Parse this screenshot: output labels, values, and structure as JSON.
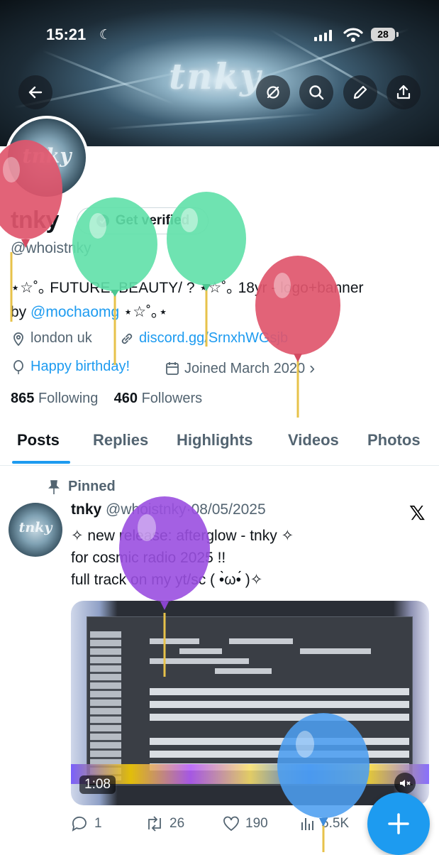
{
  "status_bar": {
    "time": "15:21",
    "battery": "28"
  },
  "banner": {
    "logo_text": "tnky"
  },
  "header_buttons": [
    "back",
    "hide",
    "search",
    "edit",
    "share"
  ],
  "profile": {
    "avatar_text": "tnky",
    "name": "tnky",
    "handle": "@whoistnky",
    "get_verified_label": "Get verified",
    "bio_line1": "⋆☆˚｡ FUTURE..BEAUTY/ ? ⋆☆˚｡ 18yr - logo+banner",
    "bio_line2_prefix": "by ",
    "bio_mention": "@mochaomg",
    "bio_line2_suffix": " ⋆☆˚｡⋆",
    "location": "london uk",
    "website": "discord.gg/SrnxhWGsjb",
    "birthday": "Happy birthday!",
    "joined": "Joined March 2020",
    "following_count": "865",
    "following_label": "Following",
    "followers_count": "460",
    "followers_label": "Followers"
  },
  "tabs": [
    {
      "label": "Posts",
      "active": true
    },
    {
      "label": "Replies"
    },
    {
      "label": "Highlights"
    },
    {
      "label": "Videos"
    },
    {
      "label": "Photos"
    }
  ],
  "post": {
    "pinned_label": "Pinned",
    "avatar_text": "tnky",
    "author": "tnky",
    "handle": "@whoistnky",
    "separator": "·",
    "date": "08/05/2025",
    "text_line1": "✧ new release: afterglow - tnky ✧",
    "text_line2": "for cosmic radio 2025 !!",
    "text_line3": "full track on my yt/sc ( •̀ω•́ )✧",
    "video_duration": "1:08",
    "replies": "1",
    "reposts": "26",
    "likes": "190",
    "views": "5.5K"
  },
  "colors": {
    "accent": "#1d9bf0",
    "text": "#0f1419",
    "secondary": "#536471"
  },
  "balloon_colors": [
    "#e0566c",
    "#5fe0a8",
    "#5fe0a8",
    "#e0566c",
    "#9a4fe0",
    "#4c9ef0"
  ]
}
